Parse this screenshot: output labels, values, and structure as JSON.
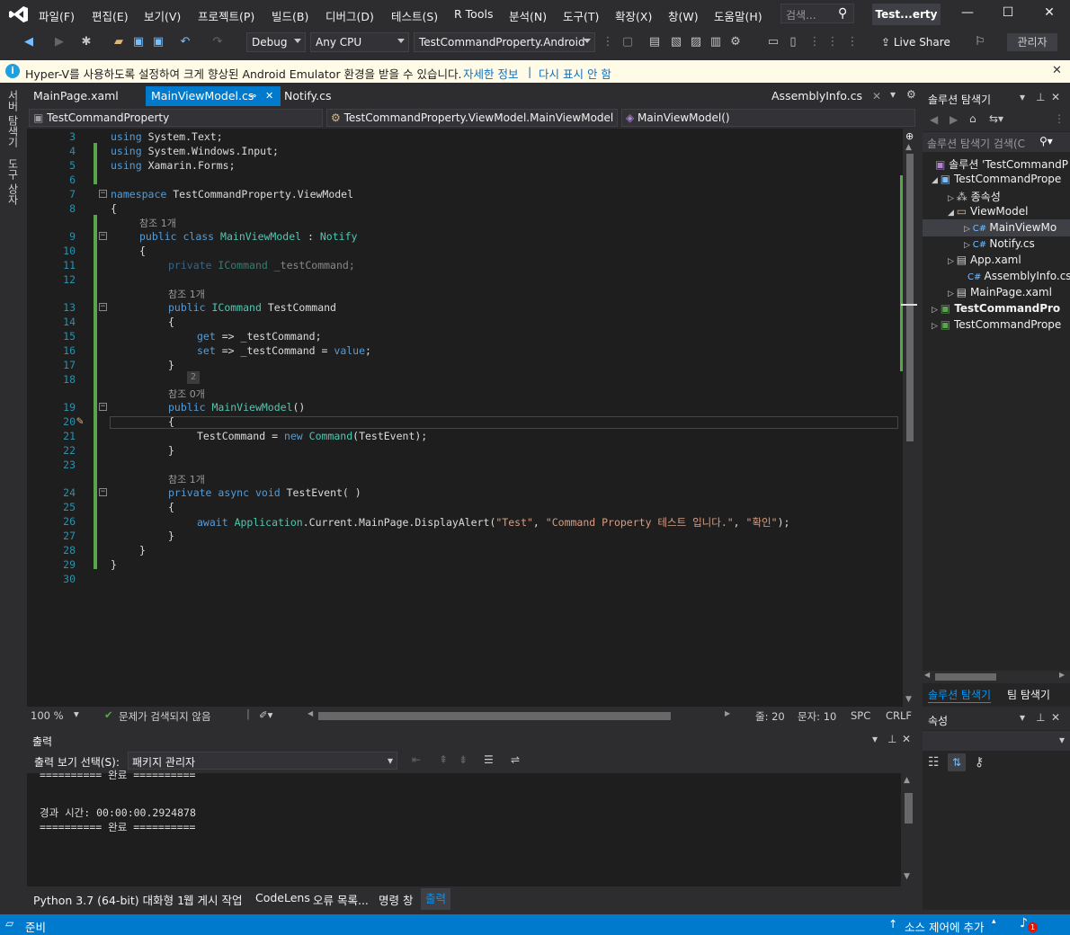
{
  "menu": [
    "파일(F)",
    "편집(E)",
    "보기(V)",
    "프로젝트(P)",
    "빌드(B)",
    "디버그(D)",
    "테스트(S)",
    "R Tools",
    "분석(N)",
    "도구(T)",
    "확장(X)",
    "창(W)",
    "도움말(H)"
  ],
  "search_placeholder": "검색...",
  "title_short": "Test...erty",
  "toolbar": {
    "config": "Debug",
    "platform": "Any CPU",
    "startup": "TestCommandProperty.Android",
    "live_share": "Live Share",
    "admin": "관리자"
  },
  "infobar": {
    "message": "Hyper-V를 사용하도록 설정하여 크게 향상된 Android Emulator 환경을 받을 수 있습니다.",
    "link1": "자세한 정보",
    "sep": "|",
    "link2": "다시 표시 안 함"
  },
  "left_tabs": [
    "서버 탐색기",
    "도구 상자"
  ],
  "doc_tabs": {
    "t1": "MainPage.xaml",
    "t2": "MainViewModel.cs",
    "t3": "Notify.cs",
    "t4": "AssemblyInfo.cs"
  },
  "nav": {
    "project": "TestCommandProperty",
    "class": "TestCommandProperty.ViewModel.MainViewModel",
    "member": "MainViewModel()"
  },
  "refs": {
    "r1": "참조 1개",
    "r0": "참조 0개",
    "badge": "2"
  },
  "lines": [
    "3",
    "4",
    "5",
    "6",
    "7",
    "8",
    "9",
    "10",
    "11",
    "12",
    "13",
    "14",
    "15",
    "16",
    "17",
    "18",
    "19",
    "20",
    "21",
    "22",
    "23",
    "24",
    "25",
    "26",
    "27",
    "28",
    "29",
    "30"
  ],
  "code": {
    "using": "using",
    "ns_text": "System.Text;",
    "ns_input": "System.Windows.Input;",
    "ns_forms": "Xamarin.Forms;",
    "namespace": "namespace",
    "ns_name": "TestCommandProperty.ViewModel",
    "public": "public",
    "class": "class",
    "class_name": "MainViewModel",
    "colon": ":",
    "notify": "Notify",
    "private": "private",
    "icommand": "ICommand",
    "field": "_testCommand;",
    "prop": "TestCommand",
    "get": "get",
    "set": "set",
    "arrow": "=>",
    "get_body": "_testCommand;",
    "set_lhs": "_testCommand =",
    "value": "value",
    "semi": ";",
    "ctor": "MainViewModel",
    "parens": "()",
    "assign_lhs": "TestCommand =",
    "new": "new",
    "command": "Command",
    "ctor_arg": "(TestEvent);",
    "async": "async",
    "void": "void",
    "method": "TestEvent",
    "method_parens": "( )",
    "await": "await",
    "application": "Application",
    "call": ".Current.MainPage.DisplayAlert(",
    "s1": "\"Test\"",
    "comma": ",",
    "s2": "\"Command Property 테스트 입니다.\"",
    "s3": "\"확인\"",
    "call_end": ");",
    "open": "{",
    "close": "}"
  },
  "editor_status": {
    "zoom": "100 %",
    "issues": "문제가 검색되지 않음",
    "line": "줄: 20",
    "col": "문자: 10",
    "spc": "SPC",
    "crlf": "CRLF"
  },
  "output": {
    "title": "출력",
    "show_label": "출력 보기 선택(S):",
    "source": "패키지 관리자",
    "line1": "========== 완료 ==========",
    "line2": "경과 시간: 00:00:00.2924878",
    "line3": "========== 완료 =========="
  },
  "bottom_tabs": [
    "Python 3.7 (64-bit) 대화형 1",
    "웹 게시 작업",
    "CodeLens",
    "오류 목록...",
    "명령 창",
    "출력"
  ],
  "status": {
    "ready": "준비",
    "source_control": "소스 제어에 추가",
    "badge": "1"
  },
  "solution": {
    "title": "솔루션 탐색기",
    "search": "솔루션 탐색기 검색(C",
    "items": [
      "솔루션 'TestCommandP",
      "TestCommandPrope",
      "종속성",
      "ViewModel",
      "MainViewMo",
      "Notify.cs",
      "App.xaml",
      "AssemblyInfo.cs",
      "MainPage.xaml",
      "TestCommandPro",
      "TestCommandPrope"
    ],
    "tab1": "솔루션 탐색기",
    "tab2": "팀 탐색기"
  },
  "props_title": "속성",
  "colors": {
    "accent": "#007acc",
    "bg": "#1e1e1e",
    "keyword": "#569cd6",
    "type": "#4ec9b0",
    "string": "#d69d85",
    "linenum": "#2b91af",
    "info": "#fffbe6"
  }
}
